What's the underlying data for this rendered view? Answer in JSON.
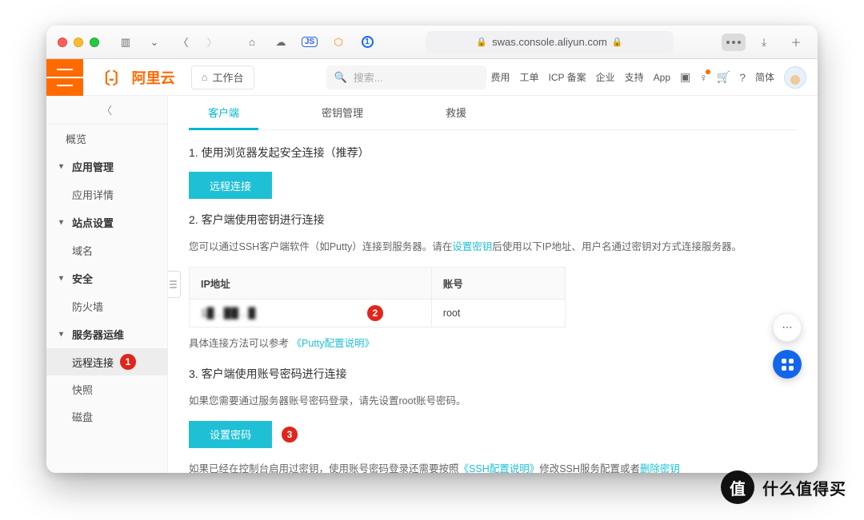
{
  "toolbar": {
    "url": "swas.console.aliyun.com"
  },
  "header": {
    "logo_text": "阿里云",
    "workspace": "工作台",
    "search_placeholder": "搜索...",
    "links": [
      "费用",
      "工单",
      "ICP 备案",
      "企业",
      "支持",
      "App"
    ],
    "lang": "简体"
  },
  "sidebar": {
    "overview": "概览",
    "groups": [
      {
        "label": "应用管理",
        "items": [
          "应用详情"
        ]
      },
      {
        "label": "站点设置",
        "items": [
          "域名"
        ]
      },
      {
        "label": "安全",
        "items": [
          "防火墙"
        ]
      },
      {
        "label": "服务器运维",
        "items": [
          "远程连接",
          "快照",
          "磁盘"
        ]
      }
    ]
  },
  "tabs": {
    "client": "客户端",
    "keys": "密钥管理",
    "rescue": "救援"
  },
  "sec1": {
    "title": "1. 使用浏览器发起安全连接（推荐）",
    "button": "远程连接"
  },
  "sec2": {
    "title": "2. 客户端使用密钥进行连接",
    "desc_a": "您可以通过SSH客户端软件（如Putty）连接到服务器。请在",
    "link1": "设置密钥",
    "desc_b": "后使用以下IP地址、用户名通过密钥对方式连接服务器。",
    "th_ip": "IP地址",
    "th_acct": "账号",
    "ip_masked": "1█ . ██ . █",
    "acct": "root",
    "foot_a": "具体连接方法可以参考",
    "foot_link": "《Putty配置说明》"
  },
  "sec3": {
    "title": "3. 客户端使用账号密码进行连接",
    "desc": "如果您需要通过服务器账号密码登录，请先设置root账号密码。",
    "button": "设置密码",
    "foot_a": "如果已经在控制台启用过密钥，使用账号密码登录还需要按照",
    "foot_link1": "《SSH配置说明》",
    "foot_b": "修改SSH服务配置或者",
    "foot_link2": "删除密钥"
  },
  "badges": {
    "b1": "1",
    "b2": "2",
    "b3": "3"
  },
  "brand": {
    "circle": "值",
    "text": "什么值得买"
  }
}
